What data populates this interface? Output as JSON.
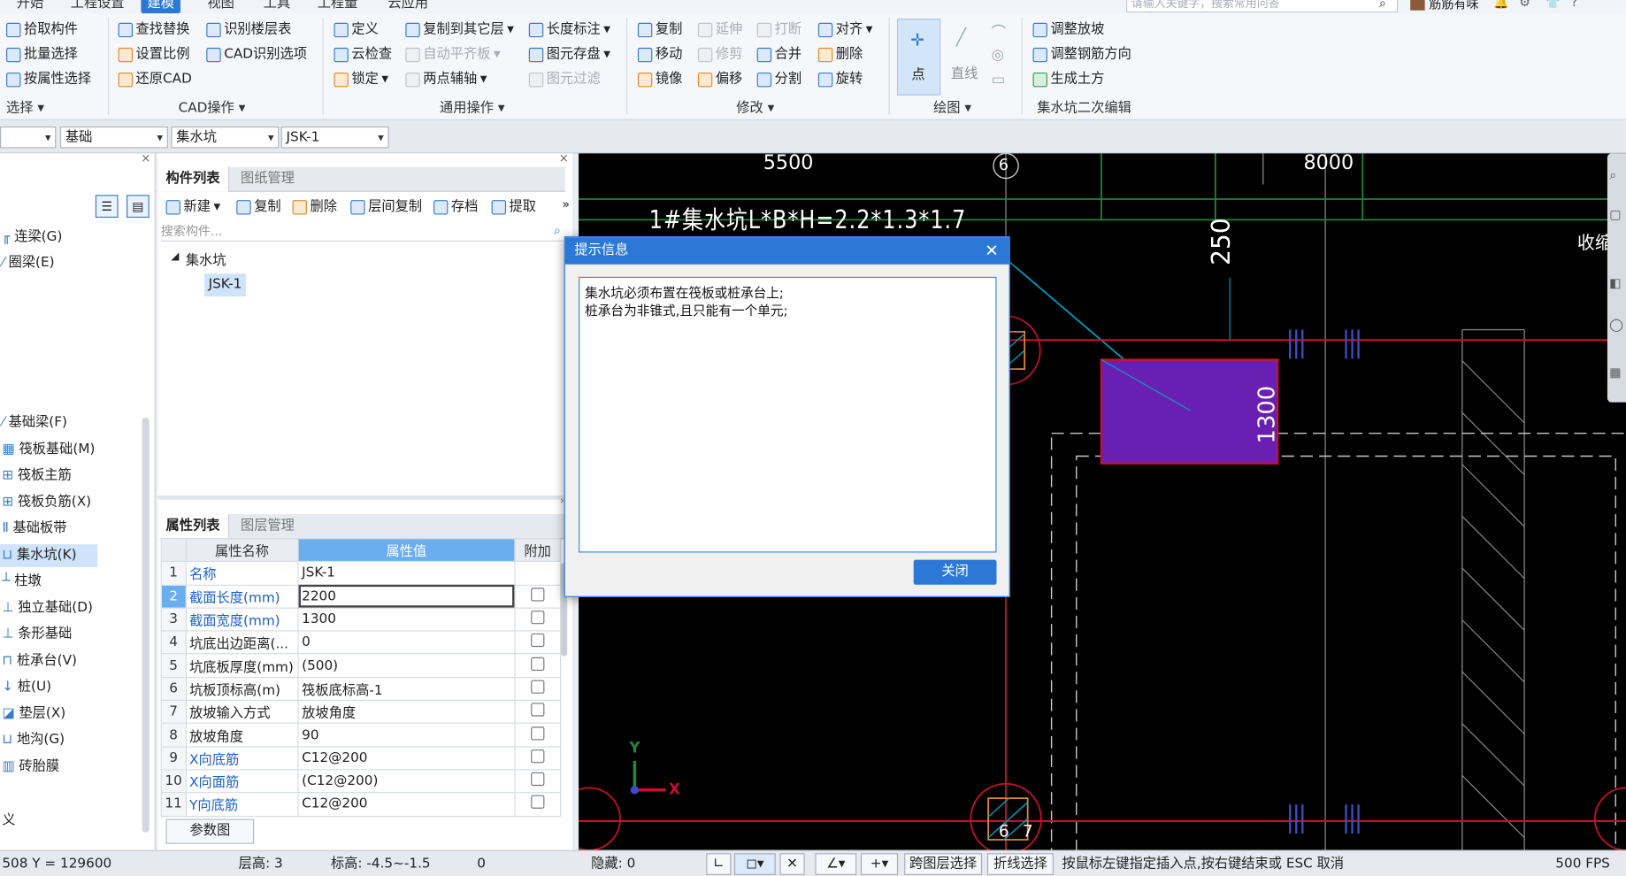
{
  "menubar": {
    "items": [
      "开始",
      "工程设置",
      "建模",
      "视图",
      "工具",
      "工程量",
      "云应用"
    ],
    "active": "建模",
    "search_placeholder": "请输入关键字，搜索常用问答",
    "user": "筋筋有味"
  },
  "ribbon": {
    "select_group": {
      "items": [
        "拾取构件",
        "批量选择",
        "按属性选择"
      ],
      "label": "选择"
    },
    "cad_group": {
      "items": [
        "查找替换",
        "识别楼层表",
        "设置比例",
        "CAD识别选项",
        "还原CAD"
      ],
      "label": "CAD操作"
    },
    "general_group": {
      "items": [
        "定义",
        "复制到其它层",
        "长度标注",
        "云检查",
        "自动平齐板",
        "图元存盘",
        "锁定",
        "两点辅轴",
        "图元过滤"
      ],
      "label": "通用操作"
    },
    "modify_group": {
      "items": [
        "复制",
        "延伸",
        "打断",
        "对齐",
        "移动",
        "修剪",
        "合并",
        "删除",
        "镜像",
        "偏移",
        "分割",
        "旋转"
      ],
      "label": "修改"
    },
    "draw_group": {
      "items": [
        "点",
        "直线"
      ],
      "label": "绘图"
    },
    "secondary_group": {
      "items": [
        "调整放坡",
        "调整钢筋方向",
        "生成土方"
      ],
      "label": "集水坑二次编辑"
    }
  },
  "propbar": {
    "selects": [
      "",
      "基础",
      "集水坑",
      "JSK-1"
    ]
  },
  "left_nav": {
    "items": [
      "连梁(G)",
      "圈梁(E)",
      "基础梁(F)",
      "筏板基础(M)",
      "筏板主筋",
      "筏板负筋(X)",
      "基础板带",
      "集水坑(K)",
      "柱墩",
      "独立基础(D)",
      "条形基础",
      "桩承台(V)",
      "桩(U)",
      "垫层(X)",
      "地沟(G)",
      "砖胎膜",
      "义"
    ],
    "selected": "集水坑(K)"
  },
  "component_panel": {
    "tabs": [
      "构件列表",
      "图纸管理"
    ],
    "toolbar": [
      "新建",
      "复制",
      "删除",
      "层间复制",
      "存档",
      "提取"
    ],
    "search_placeholder": "搜索构件...",
    "tree_root": "集水坑",
    "tree_child": "JSK-1"
  },
  "property_panel": {
    "tabs": [
      "属性列表",
      "图层管理"
    ],
    "headers": [
      "属性名称",
      "属性值",
      "附加"
    ],
    "rows": [
      {
        "no": "1",
        "name": "名称",
        "value": "JSK-1"
      },
      {
        "no": "2",
        "name": "截面长度(mm)",
        "value": "2200"
      },
      {
        "no": "3",
        "name": "截面宽度(mm)",
        "value": "1300"
      },
      {
        "no": "4",
        "name": "坑底出边距离(...",
        "value": "0"
      },
      {
        "no": "5",
        "name": "坑底板厚度(mm)",
        "value": "(500)"
      },
      {
        "no": "6",
        "name": "坑板顶标高(m)",
        "value": "筏板底标高-1"
      },
      {
        "no": "7",
        "name": "放坡输入方式",
        "value": "放坡角度"
      },
      {
        "no": "8",
        "name": "放坡角度",
        "value": "90"
      },
      {
        "no": "9",
        "name": "X向底筋",
        "value": "C12@200"
      },
      {
        "no": "10",
        "name": "X向面筋",
        "value": "(C12@200)"
      },
      {
        "no": "11",
        "name": "Y向底筋",
        "value": "C12@200"
      }
    ],
    "param_button": "参数图"
  },
  "canvas": {
    "dims": [
      "5500",
      "8000",
      "250",
      "1300"
    ],
    "axis_labels": [
      "6",
      "6",
      "7"
    ],
    "annotation": "1#集水坑L*B*H=2.2*1.3*1.7",
    "side_text": "收缩",
    "ucs_y": "Y",
    "ucs_x": "X",
    "colors": {
      "pit": "#6a1fb3",
      "gridline": "#c8102e",
      "cyan": "#00a0c0",
      "green": "#1b8a3a"
    }
  },
  "dialog": {
    "title": "提示信息",
    "lines": [
      "集水坑必须布置在筏板或桩承台上;",
      "桩承台为非锥式,且只能有一个单元;"
    ],
    "close_button": "关闭"
  },
  "statusbar": {
    "coords": "508 Y = 129600",
    "floor_height": "层高:  3",
    "elevation": "标高:  -4.5~-1.5",
    "value": "0",
    "hidden": "隐藏:  0",
    "cross_layer": "跨图层选择",
    "polyline": "折线选择",
    "hint": "按鼠标左键指定插入点,按右键结束或 ESC 取消",
    "fps": "500 FPS"
  }
}
